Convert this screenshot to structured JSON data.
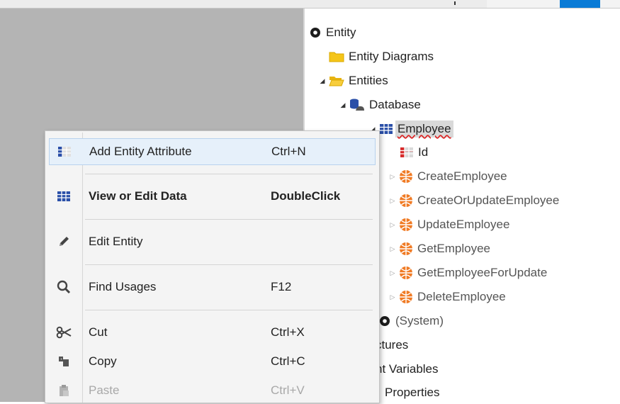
{
  "colors": {
    "accent": "#0a7bd6",
    "canvas": "#b4b4b4",
    "menu_bg": "#f4f4f4",
    "highlight": "#e6f0fa",
    "action_icon": "#f07a23",
    "table_icon": "#2a4fa8"
  },
  "tree": {
    "root": {
      "label": "Entity",
      "icon": "circle-icon"
    },
    "entity_diagrams": {
      "label": "Entity Diagrams",
      "icon": "folder-icon"
    },
    "entities": {
      "label": "Entities",
      "icon": "open-folder-icon"
    },
    "database": {
      "label": "Database",
      "icon": "database-icon"
    },
    "employee": {
      "label": "Employee",
      "icon": "entity-table-icon"
    },
    "attribute_id": {
      "label": "Id",
      "icon": "identifier-icon"
    },
    "actions": [
      {
        "label": "CreateEmployee"
      },
      {
        "label": "CreateOrUpdateEmployee"
      },
      {
        "label": "UpdateEmployee"
      },
      {
        "label": "GetEmployee"
      },
      {
        "label": "GetEmployeeForUpdate"
      },
      {
        "label": "DeleteEmployee"
      }
    ],
    "system": {
      "label": "(System)"
    },
    "structures_partial": "ctures",
    "variables_partial": "nt Variables",
    "properties_partial": "Properties"
  },
  "context_menu": {
    "add_attribute": {
      "label": "Add Entity Attribute",
      "shortcut": "Ctrl+N"
    },
    "view_edit": {
      "label": "View or Edit Data",
      "shortcut": "DoubleClick"
    },
    "edit_entity": {
      "label": "Edit Entity"
    },
    "find_usages": {
      "label": "Find Usages",
      "shortcut": "F12"
    },
    "cut": {
      "label": "Cut",
      "shortcut": "Ctrl+X"
    },
    "copy": {
      "label": "Copy",
      "shortcut": "Ctrl+C"
    },
    "paste": {
      "label": "Paste",
      "shortcut": "Ctrl+V"
    }
  }
}
